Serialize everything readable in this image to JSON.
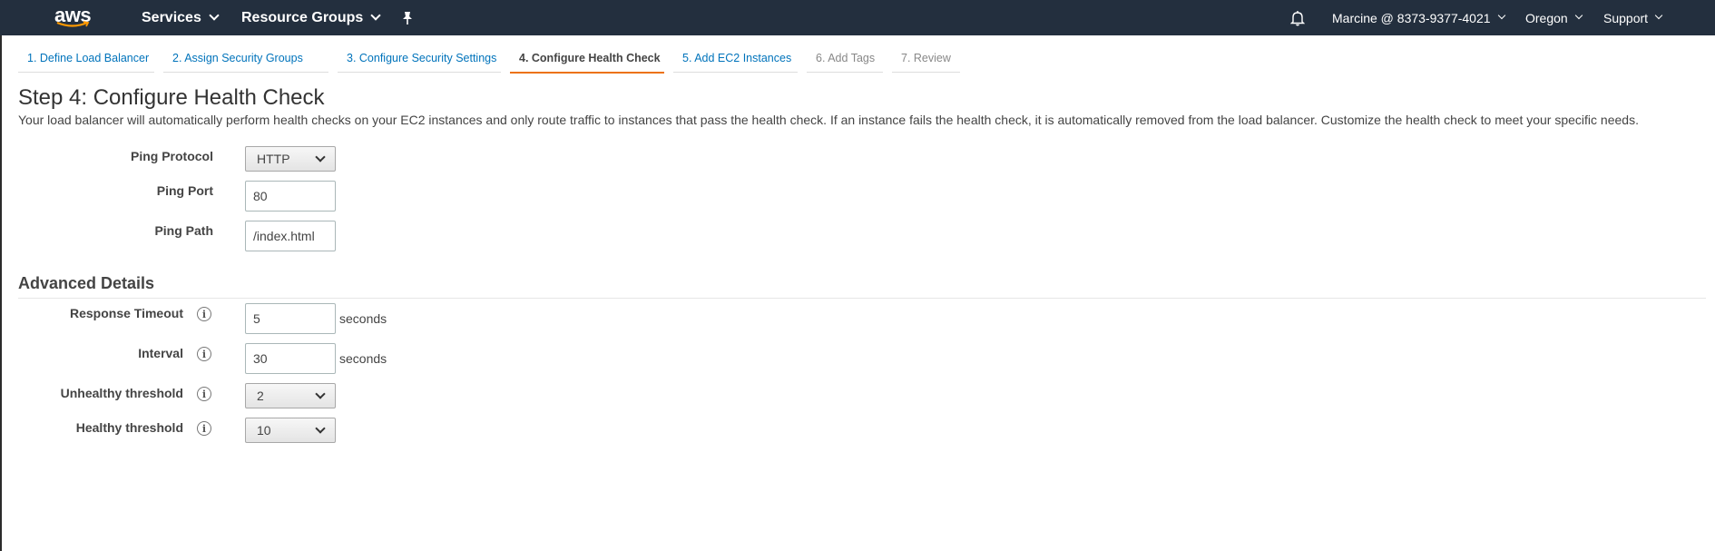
{
  "nav": {
    "logo": "aws",
    "services": "Services",
    "resource_groups": "Resource Groups",
    "account": "Marcine @ 8373-9377-4021",
    "region": "Oregon",
    "support": "Support",
    "icons": [
      "pin-icon",
      "bell-icon"
    ]
  },
  "wizard_tabs": [
    {
      "label": "1. Define Load Balancer",
      "state": "link"
    },
    {
      "label": "2. Assign Security Groups",
      "state": "link"
    },
    {
      "label": "3. Configure Security Settings",
      "state": "link"
    },
    {
      "label": "4. Configure Health Check",
      "state": "active"
    },
    {
      "label": "5. Add EC2 Instances",
      "state": "link"
    },
    {
      "label": "6. Add Tags",
      "state": "disabled"
    },
    {
      "label": "7. Review",
      "state": "disabled"
    }
  ],
  "step": {
    "title": "Step 4: Configure Health Check",
    "description": "Your load balancer will automatically perform health checks on your EC2 instances and only route traffic to instances that pass the health check. If an instance fails the health check, it is automatically removed from the load balancer. Customize the health check to meet your specific needs."
  },
  "health_check": {
    "ping_protocol_label": "Ping Protocol",
    "ping_protocol_value": "HTTP",
    "ping_port_label": "Ping Port",
    "ping_port_value": "80",
    "ping_path_label": "Ping Path",
    "ping_path_value": "/index.html"
  },
  "advanced": {
    "title": "Advanced Details",
    "response_timeout_label": "Response Timeout",
    "response_timeout_value": "5",
    "interval_label": "Interval",
    "interval_value": "30",
    "unhealthy_label": "Unhealthy threshold",
    "unhealthy_value": "2",
    "healthy_label": "Healthy threshold",
    "healthy_value": "10",
    "unit_seconds": "seconds",
    "info_glyph": "i"
  },
  "colors": {
    "nav_bg": "#232f3e",
    "link": "#0073bb",
    "active_tab_underline": "#ec7211"
  }
}
